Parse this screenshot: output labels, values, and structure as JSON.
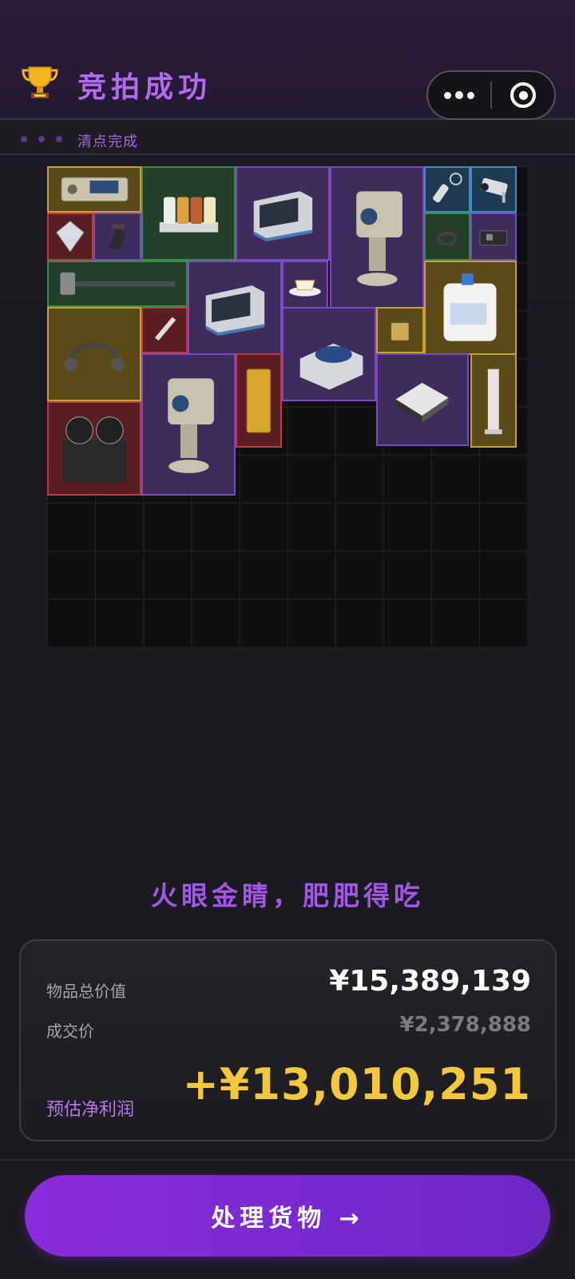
{
  "header": {
    "title": "竞拍成功",
    "trophy_icon": "trophy-icon",
    "more_icon": "more-dots-icon",
    "target_icon": "target-icon"
  },
  "subheader": {
    "status": "清点完成"
  },
  "inventory": {
    "items": [
      {
        "name": "signal-device",
        "rarity": "gold",
        "icon": "device-icon"
      },
      {
        "name": "spice-rack",
        "rarity": "green",
        "icon": "jars-icon"
      },
      {
        "name": "incubator",
        "rarity": "purple",
        "icon": "machine-icon"
      },
      {
        "name": "camera-turret",
        "rarity": "purple",
        "icon": "turret-icon"
      },
      {
        "name": "flashlight-keychain",
        "rarity": "blue",
        "icon": "flashlight-icon"
      },
      {
        "name": "security-camera",
        "rarity": "blue",
        "icon": "camera-icon"
      },
      {
        "name": "diamond",
        "rarity": "red",
        "icon": "diamond-icon"
      },
      {
        "name": "tripod-mount",
        "rarity": "purple",
        "icon": "mount-icon"
      },
      {
        "name": "cable-coil",
        "rarity": "green",
        "icon": "cable-icon"
      },
      {
        "name": "circuit-board",
        "rarity": "purple",
        "icon": "board-icon"
      },
      {
        "name": "sledgehammer",
        "rarity": "green",
        "icon": "hammer-icon"
      },
      {
        "name": "incubator-2",
        "rarity": "purple",
        "icon": "machine-icon"
      },
      {
        "name": "teacup",
        "rarity": "purple",
        "icon": "teacup-icon"
      },
      {
        "name": "water-jug",
        "rarity": "gold",
        "icon": "jug-icon"
      },
      {
        "name": "headset",
        "rarity": "gold",
        "icon": "headset-icon"
      },
      {
        "name": "fountain-pen",
        "rarity": "red",
        "icon": "pen-icon"
      },
      {
        "name": "centrifuge",
        "rarity": "purple",
        "icon": "centrifuge-icon"
      },
      {
        "name": "lighter",
        "rarity": "gold",
        "icon": "lighter-icon"
      },
      {
        "name": "camera-turret-2",
        "rarity": "purple",
        "icon": "turret-icon"
      },
      {
        "name": "gold-bar",
        "rarity": "red",
        "icon": "goldbar-icon"
      },
      {
        "name": "hard-drive",
        "rarity": "purple",
        "icon": "drive-icon"
      },
      {
        "name": "column-lamp",
        "rarity": "gold",
        "icon": "column-icon"
      },
      {
        "name": "tape-recorder",
        "rarity": "red",
        "icon": "reel-icon"
      }
    ]
  },
  "slogan": "火眼金睛，肥肥得吃",
  "summary": {
    "total_label": "物品总价值",
    "total_value": "¥15,389,139",
    "deal_label": "成交价",
    "deal_value": "¥2,378,888",
    "profit_label": "预估净利润",
    "profit_value": "+¥13,010,251"
  },
  "cta": {
    "label": "处理货物 →"
  },
  "colors": {
    "accent": "#a257e8",
    "profit": "#f3c93b",
    "cta": "#7a2ad0"
  }
}
